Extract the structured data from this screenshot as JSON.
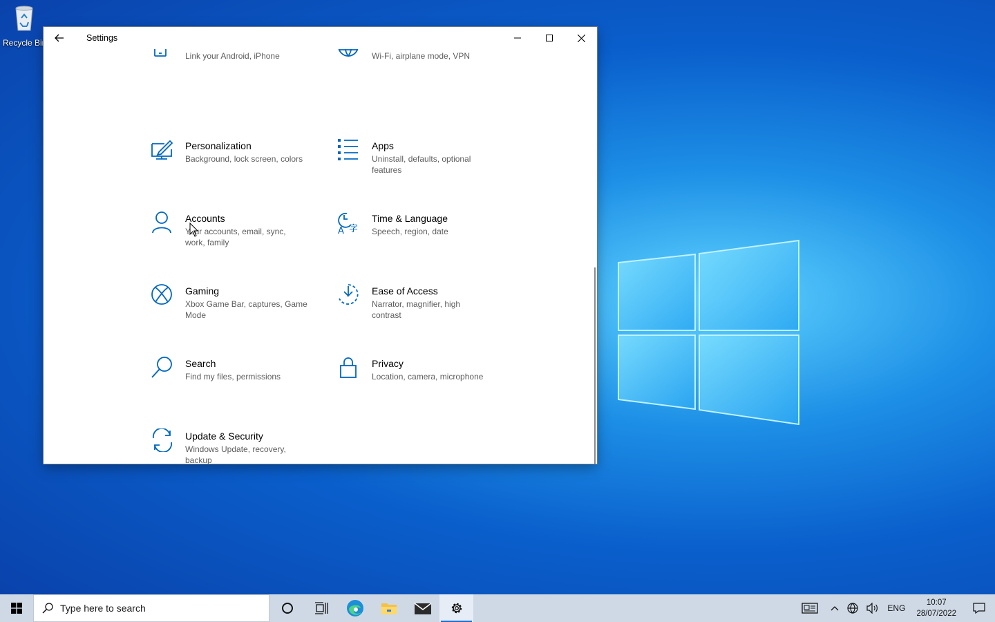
{
  "desktop": {
    "recycle_bin_label": "Recycle Bin"
  },
  "window": {
    "title": "Settings"
  },
  "tiles": [
    {
      "name": "",
      "desc": "Link your Android, iPhone",
      "icon": "phone-icon"
    },
    {
      "name": "",
      "desc": "Wi-Fi, airplane mode, VPN",
      "icon": "globe-icon"
    },
    {
      "name": "Personalization",
      "desc": "Background, lock screen, colors",
      "icon": "personalization-icon"
    },
    {
      "name": "Apps",
      "desc": "Uninstall, defaults, optional features",
      "icon": "apps-icon"
    },
    {
      "name": "Accounts",
      "desc": "Your accounts, email, sync, work, family",
      "icon": "person-icon"
    },
    {
      "name": "Time & Language",
      "desc": "Speech, region, date",
      "icon": "time-language-icon"
    },
    {
      "name": "Gaming",
      "desc": "Xbox Game Bar, captures, Game Mode",
      "icon": "xbox-icon"
    },
    {
      "name": "Ease of Access",
      "desc": "Narrator, magnifier, high contrast",
      "icon": "ease-of-access-icon"
    },
    {
      "name": "Search",
      "desc": "Find my files, permissions",
      "icon": "search-icon"
    },
    {
      "name": "Privacy",
      "desc": "Location, camera, microphone",
      "icon": "lock-icon"
    },
    {
      "name": "Update & Security",
      "desc": "Windows Update, recovery, backup",
      "icon": "sync-icon"
    }
  ],
  "taskbar": {
    "search_placeholder": "Type here to search",
    "language": "ENG",
    "time": "10:07",
    "date": "28/07/2022"
  },
  "colors": {
    "accent": "#0067c0",
    "taskbar": "#cfd9e6"
  }
}
